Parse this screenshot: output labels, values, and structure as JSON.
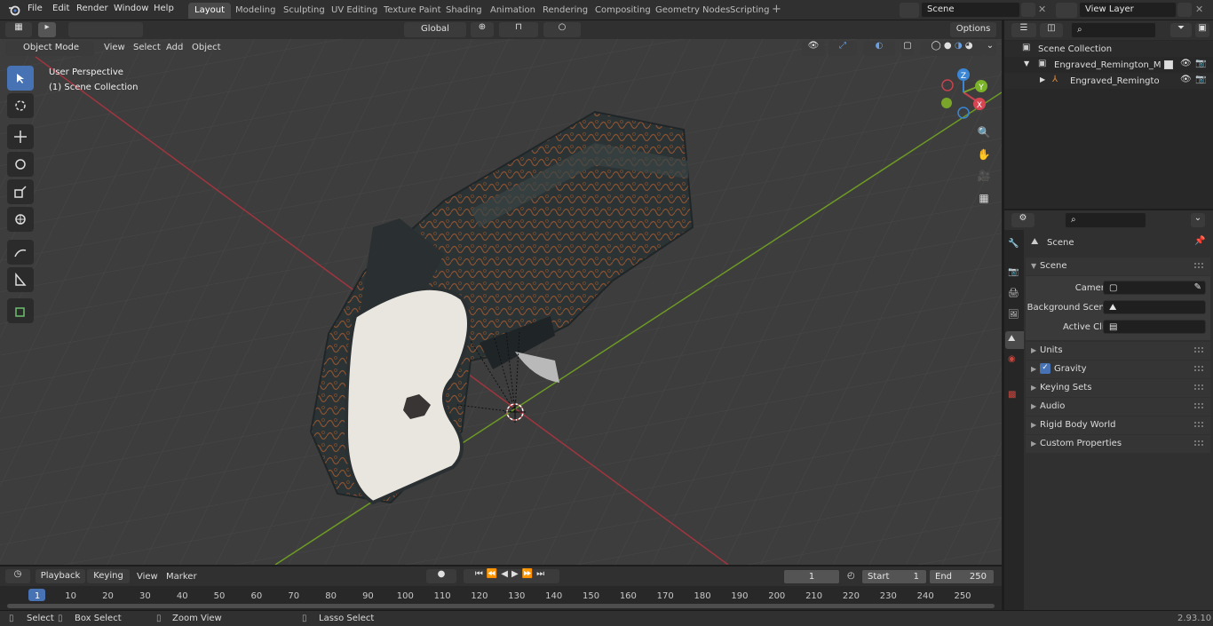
{
  "menus": {
    "file": "File",
    "edit": "Edit",
    "render": "Render",
    "window": "Window",
    "help": "Help"
  },
  "workspaces": [
    "Layout",
    "Modeling",
    "Sculpting",
    "UV Editing",
    "Texture Paint",
    "Shading",
    "Animation",
    "Rendering",
    "Compositing",
    "Geometry Nodes",
    "Scripting"
  ],
  "active_workspace": "Layout",
  "scene_name": "Scene",
  "view_layer": "View Layer",
  "viewport_header": {
    "mode": "Object Mode",
    "view": "View",
    "select": "Select",
    "add": "Add",
    "object": "Object",
    "orientation": "Global",
    "options": "Options"
  },
  "viewport_overlay": {
    "perspective": "User Perspective",
    "collection": "(1) Scene Collection"
  },
  "gizmo": {
    "x": "X",
    "y": "Y",
    "z": "Z"
  },
  "outliner": {
    "scene_collection": "Scene Collection",
    "items": [
      {
        "label": "Engraved_Remington_Model_"
      },
      {
        "label": "Engraved_Remington_Mo"
      }
    ]
  },
  "properties": {
    "context": "Scene",
    "section": "Scene",
    "fields": [
      {
        "label": "Camera"
      },
      {
        "label": "Background Scene"
      },
      {
        "label": "Active Clip"
      }
    ],
    "panels": [
      "Units",
      "Gravity",
      "Keying Sets",
      "Audio",
      "Rigid Body World",
      "Custom Properties"
    ],
    "gravity_enabled": true
  },
  "timeline": {
    "playback": "Playback",
    "keying": "Keying",
    "view": "View",
    "marker": "Marker",
    "current_frame": "1",
    "start_label": "Start",
    "start": "1",
    "end_label": "End",
    "end": "250",
    "ticks": [
      "1",
      "10",
      "20",
      "30",
      "40",
      "50",
      "60",
      "70",
      "80",
      "90",
      "100",
      "110",
      "120",
      "130",
      "140",
      "150",
      "160",
      "170",
      "180",
      "190",
      "200",
      "210",
      "220",
      "230",
      "240",
      "250"
    ]
  },
  "statusbar": {
    "select": "Select",
    "box_select": "Box Select",
    "zoom_view": "Zoom View",
    "lasso": "Lasso Select",
    "version": "2.93.10"
  },
  "colors": {
    "accent": "#4772b3",
    "x_axis": "#c8424e",
    "y_axis": "#7aa52a",
    "z_axis": "#3a86d4"
  }
}
